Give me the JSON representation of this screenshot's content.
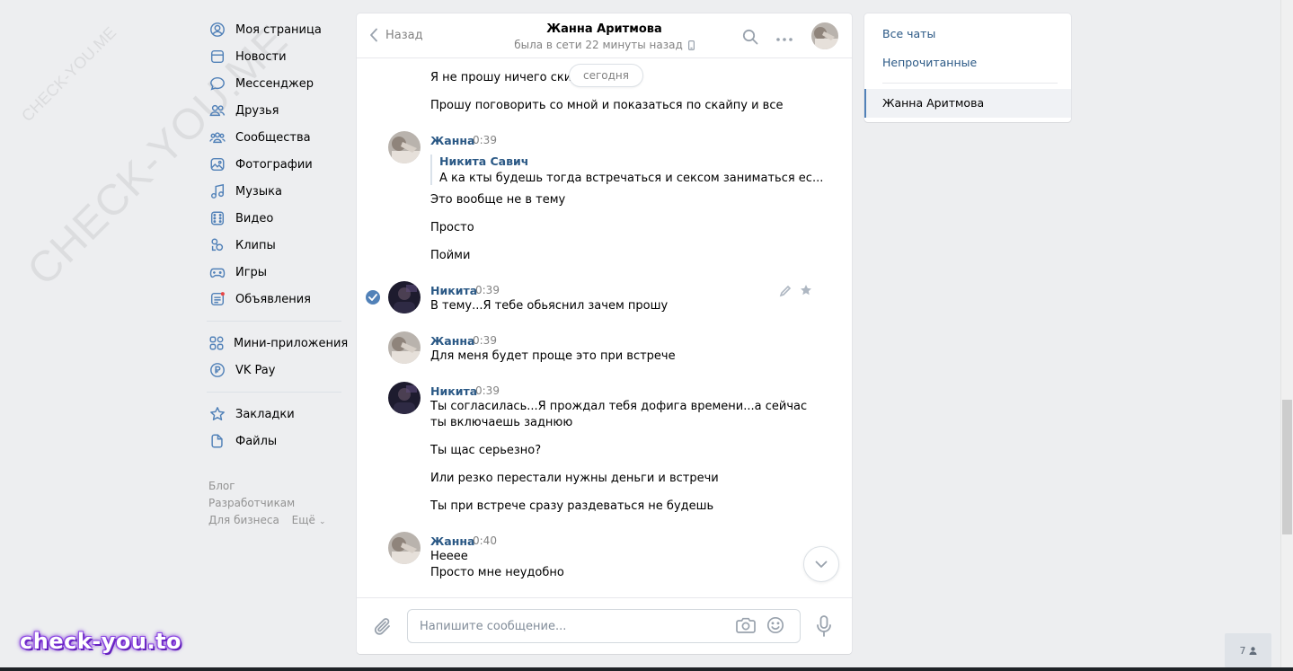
{
  "watermark": {
    "large": "CHECK-YOU.ME",
    "small": "CHECK-YOU.ME"
  },
  "brand_logo": "check-you.to",
  "nav": {
    "main": [
      {
        "label": "Моя страница",
        "icon": "user-circle-icon"
      },
      {
        "label": "Новости",
        "icon": "newspaper-icon"
      },
      {
        "label": "Мессенджер",
        "icon": "chat-bubble-icon"
      },
      {
        "label": "Друзья",
        "icon": "friends-icon"
      },
      {
        "label": "Сообщества",
        "icon": "communities-icon"
      },
      {
        "label": "Фотографии",
        "icon": "photo-icon"
      },
      {
        "label": "Музыка",
        "icon": "music-note-icon"
      },
      {
        "label": "Видео",
        "icon": "video-icon"
      },
      {
        "label": "Клипы",
        "icon": "clips-icon"
      },
      {
        "label": "Игры",
        "icon": "gamepad-icon"
      },
      {
        "label": "Объявления",
        "icon": "classifieds-icon"
      }
    ],
    "apps": [
      {
        "label": "Мини-приложения",
        "icon": "mini-apps-icon"
      },
      {
        "label": "VK Pay",
        "icon": "vk-pay-icon"
      }
    ],
    "saved": [
      {
        "label": "Закладки",
        "icon": "star-icon"
      },
      {
        "label": "Файлы",
        "icon": "file-icon"
      }
    ],
    "footer": {
      "blog": "Блог",
      "developers": "Разработчикам",
      "business": "Для бизнеса",
      "more": "Ещё"
    }
  },
  "chat": {
    "back_label": "Назад",
    "peer_name": "Жанна Аритмова",
    "peer_status": "была в сети 22 минуты назад",
    "date_pill": "сегодня",
    "messages": {
      "m0": "Я не прошу ничего скиды",
      "m1": "Прошу поговорить со мной и показаться по скайпу и все",
      "g1_author": "Жанна",
      "g1_time": "0:39",
      "quote_author": "Никита Савич",
      "quote_text": "А ка кты будешь тогда встречаться и сексом заниматься ес...",
      "g1_l1": "Это вообще не в тему",
      "g1_l2": "Просто",
      "g1_l3": "Пойми",
      "g2_author": "Никита",
      "g2_time": "0:39",
      "g2_l1": "В тему...Я тебе обьяснил зачем прошу",
      "g3_author": "Жанна",
      "g3_time": "0:39",
      "g3_l1": "Для меня будет проще это при встрече",
      "g4_author": "Никита",
      "g4_time": "0:39",
      "g4_l1": "Ты согласилась...Я прождал тебя дофига времени...а сейчас",
      "g4_l2": "ты включаешь заднюю",
      "g4_l3": "Ты щас серьезно?",
      "g4_l4": "Или резко перестали нужны деньги и встречи",
      "g4_l5": "Ты при встрече сразу раздеваться не будешь",
      "g5_author": "Жанна",
      "g5_time": "0:40",
      "g5_l1": "Нееее",
      "g5_l2": "Просто мне неудобно"
    },
    "composer_placeholder": "Напишите сообщение..."
  },
  "right_panel": {
    "all_chats": "Все чаты",
    "unread": "Непрочитанные",
    "active_chat": "Жанна Аритмова"
  },
  "badge_count": "7",
  "colors": {
    "accent": "#5181b8",
    "link": "#2a5885",
    "bg": "#edeef0"
  }
}
